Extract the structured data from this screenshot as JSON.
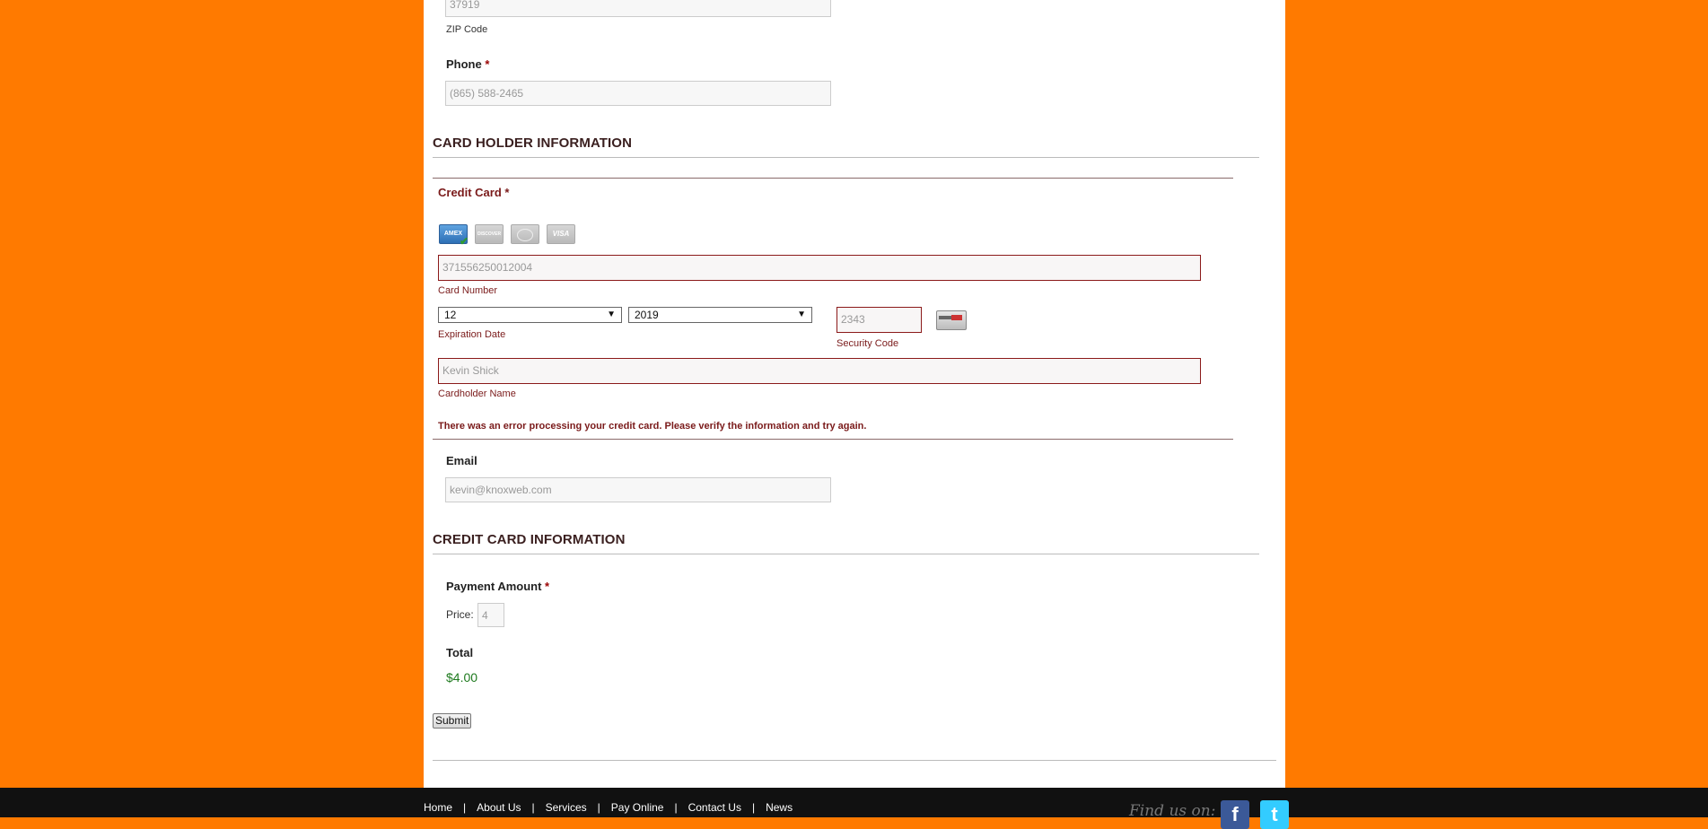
{
  "zip": {
    "value": "37919",
    "label": "ZIP Code"
  },
  "phone": {
    "label": "Phone",
    "required_mark": "*",
    "value": "(865) 588-2465"
  },
  "cardholder_section": {
    "title": "CARD HOLDER INFORMATION"
  },
  "credit_card": {
    "label": "Credit Card",
    "required_mark": "*",
    "card_types": [
      {
        "name": "AMEX",
        "selected": true
      },
      {
        "name": "DISCOVER",
        "selected": false
      },
      {
        "name": "MASTERCARD",
        "selected": false
      },
      {
        "name": "VISA",
        "selected": false
      }
    ],
    "card_number": {
      "value": "371556250012004",
      "label": "Card Number"
    },
    "expiration": {
      "month": "12",
      "year": "2019",
      "label": "Expiration Date"
    },
    "security_code": {
      "value": "2343",
      "label": "Security Code"
    },
    "cardholder_name": {
      "value": "Kevin Shick",
      "label": "Cardholder Name"
    },
    "error_message": "There was an error processing your credit card. Please verify the information and try again."
  },
  "email": {
    "label": "Email",
    "value": "kevin@knoxweb.com"
  },
  "credit_section": {
    "title": "CREDIT CARD INFORMATION"
  },
  "payment": {
    "label": "Payment Amount",
    "required_mark": "*",
    "price_label": "Price:",
    "price_value": "4"
  },
  "total": {
    "label": "Total",
    "value": "$4.00"
  },
  "submit_label": "Submit",
  "footer": {
    "nav": [
      "Home",
      "About Us",
      "Services",
      "Pay Online",
      "Contact Us",
      "News"
    ],
    "separator": "|",
    "find_us": "Find us on:",
    "social": [
      {
        "name": "facebook",
        "glyph": "f",
        "color": "#3b5998"
      },
      {
        "name": "twitter",
        "glyph": "t",
        "color": "#33ccff"
      }
    ]
  },
  "colors": {
    "background": "#ff7a00",
    "error": "#7a1a1a",
    "total": "#1e7a1e"
  }
}
